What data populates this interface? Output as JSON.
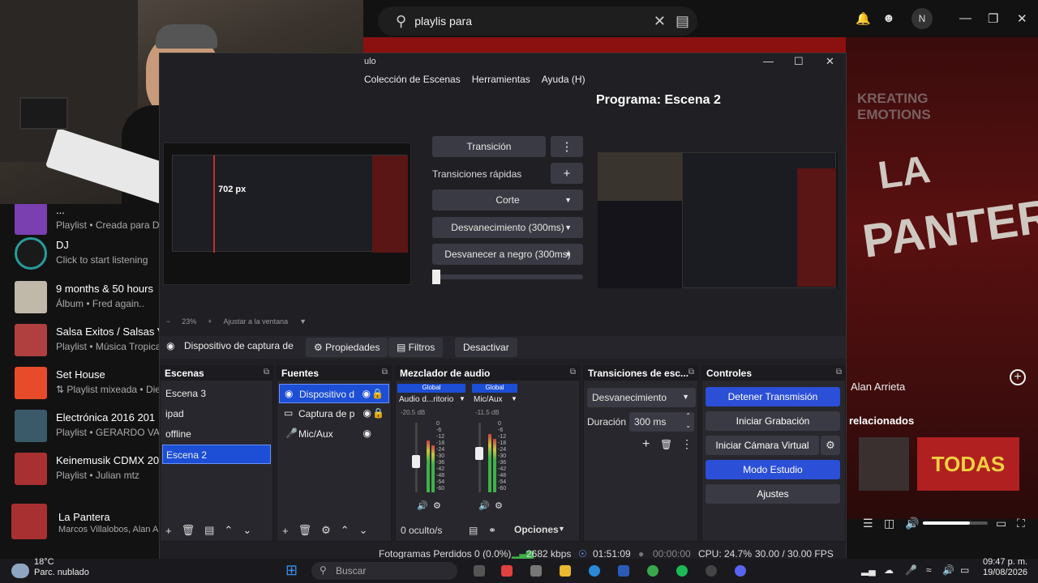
{
  "music": {
    "search_value": "playlis para",
    "now_playing_title": "La Pantera",
    "now_playing_artist": "Marcos Villalobos, Alan Arri",
    "right_artist": "Alan Arrieta",
    "right_section": "relacionados",
    "right_brand": "KREATING EMOTIONS",
    "playlists": [
      {
        "title": "...",
        "sub": "Playlist • Creada para Di",
        "color": "#7a3fb0"
      },
      {
        "title": "DJ",
        "sub": "Click to start listening",
        "color": "#2a9a9a"
      },
      {
        "title": "9 months & 50 hours",
        "sub": "Álbum • Fred again..",
        "color": "#c0b8a8"
      },
      {
        "title": "Salsa Exitos / Salsas V",
        "sub": "Playlist • Música Tropical",
        "color": "#b04040"
      },
      {
        "title": "Set House",
        "sub": "⇅ Playlist mixeada • Die",
        "color": "#e84b2a"
      },
      {
        "title": "Electrónica 2016 201",
        "sub": "Playlist • GERARDO VAC",
        "color": "#3a5a6a"
      },
      {
        "title": "Keinemusik CDMX 20",
        "sub": "Playlist • Julian mtz",
        "color": "#a83030"
      }
    ]
  },
  "obs": {
    "title": "ulo",
    "menu": [
      "Colección de Escenas",
      "Herramientas",
      "Ayuda (H)"
    ],
    "program_label": "Programa: Escena 2",
    "transition_label": "Transición",
    "quick_transitions_label": "Transiciones rápidas",
    "cut_label": "Corte",
    "fade_label": "Desvanecimiento (300ms)",
    "fade_black_label": "Desvanecer a negro (300ms)",
    "zoom": "23%",
    "fit_label": "Ajustar a la ventana",
    "source_name": "Dispositivo de captura de v",
    "properties_label": "Propiedades",
    "filters_label": "Filtros",
    "deactivate_label": "Desactivar",
    "scenes_title": "Escenas",
    "scenes": [
      "Escena 3",
      "ipad",
      "offline",
      "Escena 2"
    ],
    "sources_title": "Fuentes",
    "sources": [
      "Dispositivo d",
      "Captura de p",
      "Mic/Aux"
    ],
    "mixer_title": "Mezclador de audio",
    "mixer_channels": [
      {
        "global": "Global",
        "name": "Audio d...ritorio",
        "db": "-20.5 dB"
      },
      {
        "global": "Global",
        "name": "Mic/Aux",
        "db": "-11.5 dB"
      }
    ],
    "meter_scale": [
      "0",
      "-6",
      "-12",
      "-18",
      "-24",
      "-30",
      "-36",
      "-42",
      "-48",
      "-54",
      "-60"
    ],
    "hidden_count": "0 oculto/s",
    "options_label": "Opciones",
    "transitions_title": "Transiciones de esc...",
    "transition_select": "Desvanecimiento",
    "duration_label": "Duración",
    "duration_value": "300 ms",
    "controls_title": "Controles",
    "controls": [
      "Detener Transmisión",
      "Iniciar Grabación",
      "Iniciar Cámara Virtual",
      "Modo Estudio",
      "Ajustes"
    ],
    "status": {
      "dropped": "Fotogramas Perdidos 0 (0.0%)",
      "bitrate": "2682 kbps",
      "stream_time": "01:51:09",
      "rec_time": "00:00:00",
      "cpu": "CPU: 24.7%",
      "fps": "30.00 / 30.00 FPS"
    },
    "preview_overlay": "702 px"
  },
  "taskbar": {
    "weather_temp": "18°C",
    "weather_desc": "Parc. nublado",
    "search_placeholder": "Buscar",
    "time": "09:47 p. m.",
    "date": "19/08/2026"
  }
}
